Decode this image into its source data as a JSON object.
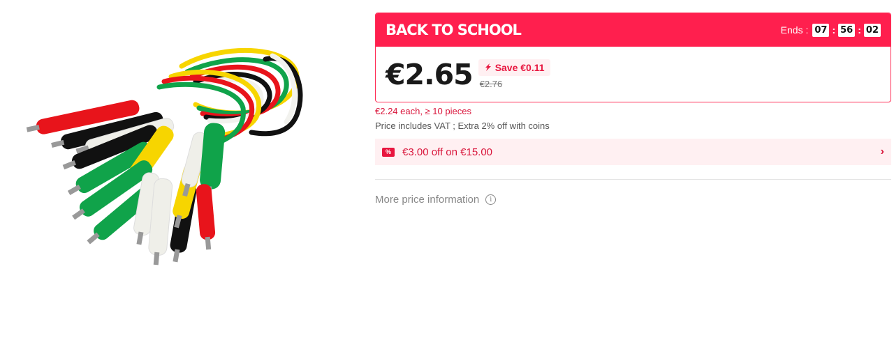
{
  "product": {
    "image_alt": "Crocodile clip test leads bundle",
    "lead_colors": [
      "#e8141b",
      "#111111",
      "#f2f2ee",
      "#f7d500",
      "#10a34a"
    ]
  },
  "promo": {
    "title": "BACK TO SCHOOL",
    "ends_label": "Ends :",
    "countdown": {
      "hours": "07",
      "minutes": "56",
      "seconds": "02",
      "separator": ":"
    }
  },
  "pricing": {
    "current_price": "€2.65",
    "save_label": "Save €0.11",
    "original_price": "€2.76",
    "bulk_price": "€2.24 each, ≥ 10 pieces",
    "vat_note": "Price includes VAT ; Extra 2% off with coins"
  },
  "coupon": {
    "icon": "coupon-icon",
    "text": "€3.00 off on €15.00"
  },
  "more_info": {
    "label": "More price information",
    "icon": "info-icon"
  },
  "colors": {
    "accent": "#ff1f4e",
    "save_text": "#e8163f",
    "coupon_bg": "#fff0f2"
  }
}
